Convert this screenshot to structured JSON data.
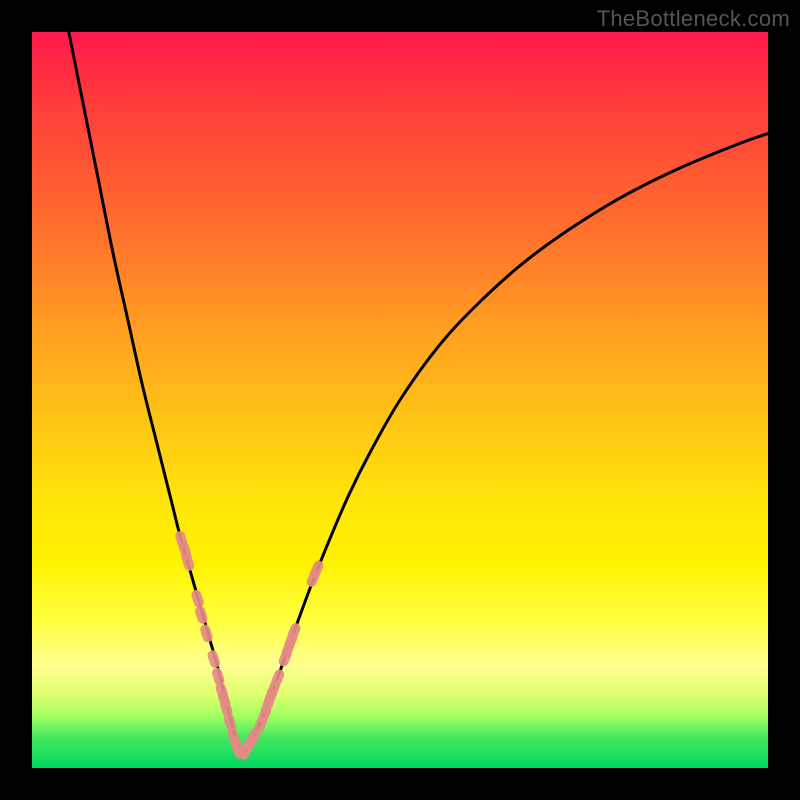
{
  "watermark": "TheBottleneck.com",
  "colors": {
    "frame": "#000000",
    "curve": "#000000",
    "marker": "#e58a86",
    "gradient_top": "#ff1a4d",
    "gradient_bottom": "#00d860"
  },
  "chart_data": {
    "type": "line",
    "title": "",
    "xlabel": "",
    "ylabel": "",
    "xlim": [
      0,
      100
    ],
    "ylim": [
      0,
      100
    ],
    "grid": false,
    "series": [
      {
        "name": "left-curve",
        "x": [
          5,
          7,
          9,
          11,
          13,
          15,
          17,
          19,
          20,
          21,
          22,
          23,
          24,
          25,
          25.5,
          26,
          26.5,
          27,
          27.5,
          28
        ],
        "y": [
          100,
          90,
          80,
          70,
          61,
          52,
          44,
          36,
          32,
          28.5,
          25,
          21.5,
          18,
          14.5,
          12.5,
          10.5,
          8.5,
          6.5,
          4.5,
          2.3
        ]
      },
      {
        "name": "right-curve",
        "x": [
          29,
          30,
          31,
          32,
          33,
          34,
          35,
          36,
          38,
          40,
          43,
          46,
          50,
          55,
          60,
          66,
          72,
          80,
          88,
          96,
          100
        ],
        "y": [
          2.3,
          4.0,
          6.0,
          8.5,
          11.2,
          14.0,
          16.8,
          19.6,
          25.0,
          30.0,
          37.0,
          43.0,
          50.0,
          57.0,
          62.5,
          68.0,
          72.5,
          77.5,
          81.5,
          84.8,
          86.2
        ]
      }
    ],
    "markers": [
      {
        "series": "left-curve",
        "x": 20.3,
        "y": 31.0
      },
      {
        "series": "left-curve",
        "x": 20.8,
        "y": 29.5
      },
      {
        "series": "left-curve",
        "x": 21.2,
        "y": 28.0
      },
      {
        "series": "left-curve",
        "x": 22.5,
        "y": 23.0
      },
      {
        "series": "left-curve",
        "x": 23.0,
        "y": 20.8
      },
      {
        "series": "left-curve",
        "x": 23.7,
        "y": 18.3
      },
      {
        "series": "left-curve",
        "x": 24.7,
        "y": 14.8
      },
      {
        "series": "left-curve",
        "x": 25.3,
        "y": 12.4
      },
      {
        "series": "left-curve",
        "x": 25.8,
        "y": 10.4
      },
      {
        "series": "left-curve",
        "x": 26.1,
        "y": 9.3
      },
      {
        "series": "left-curve",
        "x": 26.4,
        "y": 8.1
      },
      {
        "series": "left-curve",
        "x": 26.9,
        "y": 6.2
      },
      {
        "series": "left-curve",
        "x": 27.4,
        "y": 4.2
      },
      {
        "series": "left-curve",
        "x": 27.8,
        "y": 3.1
      },
      {
        "series": "left-curve",
        "x": 28.0,
        "y": 2.5
      },
      {
        "series": "right-curve",
        "x": 29.0,
        "y": 2.3
      },
      {
        "series": "right-curve",
        "x": 29.6,
        "y": 3.4
      },
      {
        "series": "right-curve",
        "x": 30.1,
        "y": 4.2
      },
      {
        "series": "right-curve",
        "x": 31.0,
        "y": 5.8
      },
      {
        "series": "right-curve",
        "x": 31.6,
        "y": 7.3
      },
      {
        "series": "right-curve",
        "x": 32.0,
        "y": 8.5
      },
      {
        "series": "right-curve",
        "x": 32.4,
        "y": 9.6
      },
      {
        "series": "right-curve",
        "x": 32.8,
        "y": 10.7
      },
      {
        "series": "right-curve",
        "x": 33.4,
        "y": 12.2
      },
      {
        "series": "right-curve",
        "x": 34.4,
        "y": 15.0
      },
      {
        "series": "right-curve",
        "x": 34.8,
        "y": 16.2
      },
      {
        "series": "right-curve",
        "x": 35.2,
        "y": 17.3
      },
      {
        "series": "right-curve",
        "x": 35.6,
        "y": 18.5
      },
      {
        "series": "right-curve",
        "x": 38.2,
        "y": 25.8
      },
      {
        "series": "right-curve",
        "x": 38.7,
        "y": 27.0
      }
    ]
  }
}
